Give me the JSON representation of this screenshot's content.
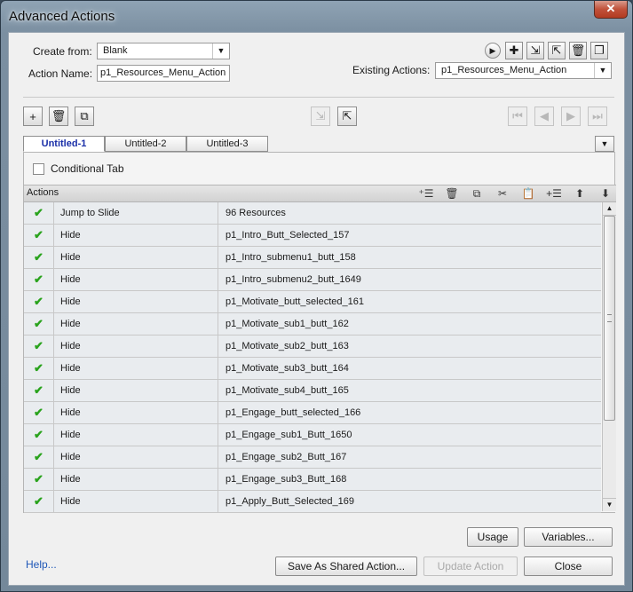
{
  "window": {
    "title": "Advanced Actions"
  },
  "form": {
    "create_from_label": "Create from:",
    "create_from_value": "Blank",
    "action_name_label": "Action Name:",
    "action_name_value": "p1_Resources_Menu_Action",
    "existing_actions_label": "Existing Actions:",
    "existing_actions_value": "p1_Resources_Menu_Action"
  },
  "icons": {
    "top": [
      "play-icon",
      "add-icon",
      "import-icon",
      "export-icon",
      "delete-icon",
      "duplicate-icon"
    ],
    "toolbar": [
      "add-icon",
      "trash-icon",
      "copy-icon",
      "import-icon",
      "export-icon"
    ],
    "nav": [
      "first-icon",
      "previous-icon",
      "next-icon",
      "last-icon"
    ],
    "actions_header": [
      "insert-icon",
      "delete-icon",
      "copy-icon",
      "cut-icon",
      "paste-icon",
      "insert-below-icon",
      "move-up-icon",
      "move-down-icon"
    ]
  },
  "tabs": [
    {
      "label": "Untitled-1",
      "active": true
    },
    {
      "label": "Untitled-2",
      "active": false
    },
    {
      "label": "Untitled-3",
      "active": false
    }
  ],
  "conditional_tab_label": "Conditional Tab",
  "actions": {
    "header_label": "Actions",
    "rows": [
      {
        "action": "Jump to Slide",
        "target": "96 Resources"
      },
      {
        "action": "Hide",
        "target": "p1_Intro_Butt_Selected_157"
      },
      {
        "action": "Hide",
        "target": "p1_Intro_submenu1_butt_158"
      },
      {
        "action": "Hide",
        "target": "p1_Intro_submenu2_butt_1649"
      },
      {
        "action": "Hide",
        "target": "p1_Motivate_butt_selected_161"
      },
      {
        "action": "Hide",
        "target": "p1_Motivate_sub1_butt_162"
      },
      {
        "action": "Hide",
        "target": "p1_Motivate_sub2_butt_163"
      },
      {
        "action": "Hide",
        "target": "p1_Motivate_sub3_butt_164"
      },
      {
        "action": "Hide",
        "target": "p1_Motivate_sub4_butt_165"
      },
      {
        "action": "Hide",
        "target": "p1_Engage_butt_selected_166"
      },
      {
        "action": "Hide",
        "target": "p1_Engage_sub1_Butt_1650"
      },
      {
        "action": "Hide",
        "target": "p1_Engage_sub2_Butt_167"
      },
      {
        "action": "Hide",
        "target": "p1_Engage_sub3_Butt_168"
      },
      {
        "action": "Hide",
        "target": "p1_Apply_Butt_Selected_169"
      }
    ]
  },
  "buttons": {
    "usage": "Usage",
    "variables": "Variables...",
    "help": "Help...",
    "save_shared": "Save As Shared Action...",
    "update_action": "Update Action",
    "close": "Close"
  },
  "colors": {
    "check": "#2aa31d",
    "active_tab_text": "#1a2fa8",
    "link": "#1f57b8"
  }
}
